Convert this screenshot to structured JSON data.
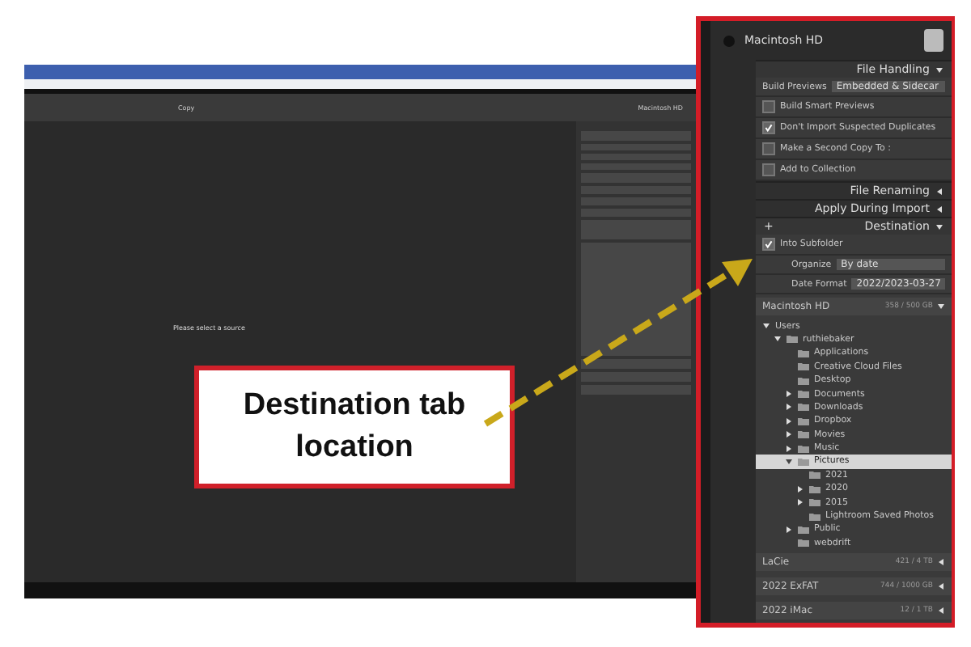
{
  "left_screenshot": {
    "toolbar": {
      "mode": "Copy",
      "volume": "Macintosh HD"
    },
    "message": "Please select a source"
  },
  "callout": {
    "text": "Destination tab location"
  },
  "panel": {
    "volume": "Macintosh HD",
    "file_handling": {
      "title": "File Handling",
      "expanded": true,
      "rows": [
        {
          "kind": "select",
          "label": "Build Previews",
          "value": "Embedded & Sidecar"
        },
        {
          "kind": "check",
          "label": "Build Smart Previews",
          "checked": false
        },
        {
          "kind": "check",
          "label": "Don't Import Suspected Duplicates",
          "checked": true
        },
        {
          "kind": "check",
          "label": "Make a Second Copy To :",
          "checked": false
        },
        {
          "kind": "check",
          "label": "Add to Collection",
          "checked": false
        }
      ]
    },
    "collapsed_sections": [
      {
        "title": "File Renaming",
        "expanded": false
      },
      {
        "title": "Apply During Import",
        "expanded": false
      }
    ],
    "destination": {
      "title": "Destination",
      "expanded": true,
      "add": "+",
      "subfolder": {
        "label": "Into Subfolder",
        "checked": true
      },
      "fields": [
        {
          "label": "Organize",
          "value": "By date"
        },
        {
          "label": "Date Format",
          "value": "2022/2023-03-27"
        }
      ],
      "volumes": [
        {
          "name": "Macintosh HD",
          "space": "358 / 500 GB",
          "expanded": true
        }
      ],
      "tree": [
        {
          "name": "Users",
          "selected": false,
          "expanded": true,
          "children": [
            {
              "name": "ruthiebaker",
              "selected": false,
              "expanded": true,
              "children": [
                {
                  "name": "Applications",
                  "selected": false
                },
                {
                  "name": "Creative Cloud Files",
                  "selected": false
                },
                {
                  "name": "Desktop",
                  "selected": false
                },
                {
                  "name": "Documents",
                  "selected": false,
                  "expanded": false
                },
                {
                  "name": "Downloads",
                  "selected": false,
                  "expanded": false
                },
                {
                  "name": "Dropbox",
                  "selected": false,
                  "expanded": false
                },
                {
                  "name": "Movies",
                  "selected": false,
                  "expanded": false
                },
                {
                  "name": "Music",
                  "selected": false,
                  "expanded": false
                },
                {
                  "name": "Pictures",
                  "selected": true,
                  "expanded": true,
                  "children": [
                    {
                      "name": "2021",
                      "selected": false
                    },
                    {
                      "name": "2020",
                      "selected": false,
                      "expanded": false
                    },
                    {
                      "name": "2015",
                      "selected": false,
                      "expanded": false
                    },
                    {
                      "name": "Lightroom Saved Photos",
                      "selected": false
                    }
                  ]
                },
                {
                  "name": "Public",
                  "selected": false,
                  "expanded": false
                },
                {
                  "name": "webdrift",
                  "selected": false
                }
              ]
            }
          ]
        }
      ],
      "other_volumes": [
        {
          "name": "LaCie",
          "space": "421 / 4 TB",
          "expanded": false
        },
        {
          "name": "2022 ExFAT",
          "space": "744 / 1000 GB",
          "expanded": false
        },
        {
          "name": "2022 iMac",
          "space": "12 / 1 TB",
          "expanded": false
        }
      ]
    }
  }
}
